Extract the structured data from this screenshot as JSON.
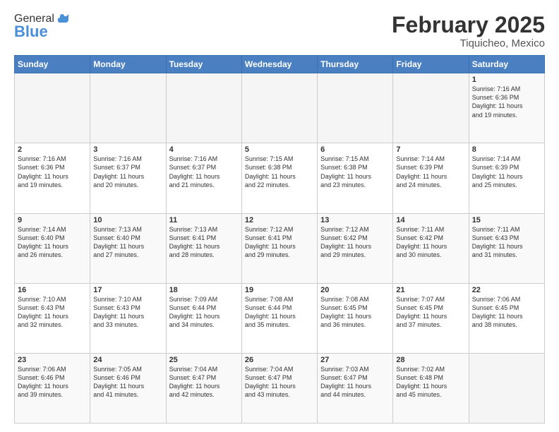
{
  "logo": {
    "line1": "General",
    "line2": "Blue"
  },
  "header": {
    "month": "February 2025",
    "location": "Tiquicheo, Mexico"
  },
  "weekdays": [
    "Sunday",
    "Monday",
    "Tuesday",
    "Wednesday",
    "Thursday",
    "Friday",
    "Saturday"
  ],
  "weeks": [
    [
      {
        "day": "",
        "info": ""
      },
      {
        "day": "",
        "info": ""
      },
      {
        "day": "",
        "info": ""
      },
      {
        "day": "",
        "info": ""
      },
      {
        "day": "",
        "info": ""
      },
      {
        "day": "",
        "info": ""
      },
      {
        "day": "1",
        "info": "Sunrise: 7:16 AM\nSunset: 6:36 PM\nDaylight: 11 hours\nand 19 minutes."
      }
    ],
    [
      {
        "day": "2",
        "info": "Sunrise: 7:16 AM\nSunset: 6:36 PM\nDaylight: 11 hours\nand 19 minutes."
      },
      {
        "day": "3",
        "info": "Sunrise: 7:16 AM\nSunset: 6:37 PM\nDaylight: 11 hours\nand 20 minutes."
      },
      {
        "day": "4",
        "info": "Sunrise: 7:16 AM\nSunset: 6:37 PM\nDaylight: 11 hours\nand 21 minutes."
      },
      {
        "day": "5",
        "info": "Sunrise: 7:15 AM\nSunset: 6:38 PM\nDaylight: 11 hours\nand 22 minutes."
      },
      {
        "day": "6",
        "info": "Sunrise: 7:15 AM\nSunset: 6:38 PM\nDaylight: 11 hours\nand 23 minutes."
      },
      {
        "day": "7",
        "info": "Sunrise: 7:14 AM\nSunset: 6:39 PM\nDaylight: 11 hours\nand 24 minutes."
      },
      {
        "day": "8",
        "info": "Sunrise: 7:14 AM\nSunset: 6:39 PM\nDaylight: 11 hours\nand 25 minutes."
      }
    ],
    [
      {
        "day": "9",
        "info": "Sunrise: 7:14 AM\nSunset: 6:40 PM\nDaylight: 11 hours\nand 26 minutes."
      },
      {
        "day": "10",
        "info": "Sunrise: 7:13 AM\nSunset: 6:40 PM\nDaylight: 11 hours\nand 27 minutes."
      },
      {
        "day": "11",
        "info": "Sunrise: 7:13 AM\nSunset: 6:41 PM\nDaylight: 11 hours\nand 28 minutes."
      },
      {
        "day": "12",
        "info": "Sunrise: 7:12 AM\nSunset: 6:41 PM\nDaylight: 11 hours\nand 29 minutes."
      },
      {
        "day": "13",
        "info": "Sunrise: 7:12 AM\nSunset: 6:42 PM\nDaylight: 11 hours\nand 29 minutes."
      },
      {
        "day": "14",
        "info": "Sunrise: 7:11 AM\nSunset: 6:42 PM\nDaylight: 11 hours\nand 30 minutes."
      },
      {
        "day": "15",
        "info": "Sunrise: 7:11 AM\nSunset: 6:43 PM\nDaylight: 11 hours\nand 31 minutes."
      }
    ],
    [
      {
        "day": "16",
        "info": "Sunrise: 7:10 AM\nSunset: 6:43 PM\nDaylight: 11 hours\nand 32 minutes."
      },
      {
        "day": "17",
        "info": "Sunrise: 7:10 AM\nSunset: 6:43 PM\nDaylight: 11 hours\nand 33 minutes."
      },
      {
        "day": "18",
        "info": "Sunrise: 7:09 AM\nSunset: 6:44 PM\nDaylight: 11 hours\nand 34 minutes."
      },
      {
        "day": "19",
        "info": "Sunrise: 7:08 AM\nSunset: 6:44 PM\nDaylight: 11 hours\nand 35 minutes."
      },
      {
        "day": "20",
        "info": "Sunrise: 7:08 AM\nSunset: 6:45 PM\nDaylight: 11 hours\nand 36 minutes."
      },
      {
        "day": "21",
        "info": "Sunrise: 7:07 AM\nSunset: 6:45 PM\nDaylight: 11 hours\nand 37 minutes."
      },
      {
        "day": "22",
        "info": "Sunrise: 7:06 AM\nSunset: 6:45 PM\nDaylight: 11 hours\nand 38 minutes."
      }
    ],
    [
      {
        "day": "23",
        "info": "Sunrise: 7:06 AM\nSunset: 6:46 PM\nDaylight: 11 hours\nand 39 minutes."
      },
      {
        "day": "24",
        "info": "Sunrise: 7:05 AM\nSunset: 6:46 PM\nDaylight: 11 hours\nand 41 minutes."
      },
      {
        "day": "25",
        "info": "Sunrise: 7:04 AM\nSunset: 6:47 PM\nDaylight: 11 hours\nand 42 minutes."
      },
      {
        "day": "26",
        "info": "Sunrise: 7:04 AM\nSunset: 6:47 PM\nDaylight: 11 hours\nand 43 minutes."
      },
      {
        "day": "27",
        "info": "Sunrise: 7:03 AM\nSunset: 6:47 PM\nDaylight: 11 hours\nand 44 minutes."
      },
      {
        "day": "28",
        "info": "Sunrise: 7:02 AM\nSunset: 6:48 PM\nDaylight: 11 hours\nand 45 minutes."
      },
      {
        "day": "",
        "info": ""
      }
    ]
  ]
}
